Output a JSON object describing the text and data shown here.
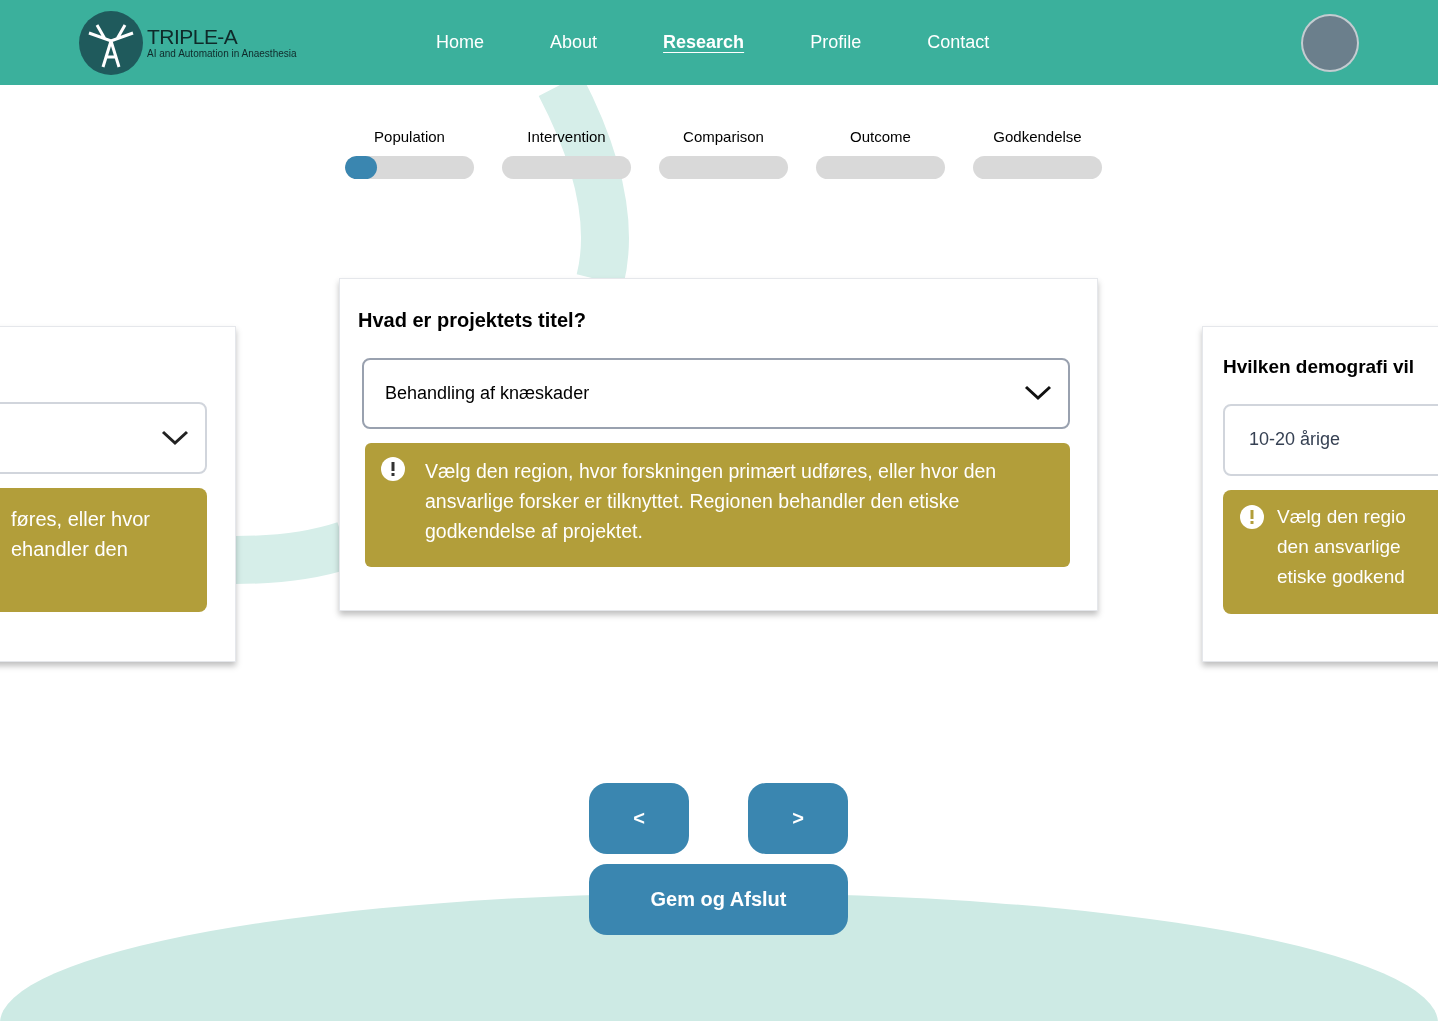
{
  "header": {
    "logo": {
      "title": "TRIPLE-A",
      "subtitle": "AI and Automation in Anaesthesia"
    },
    "nav": [
      {
        "label": "Home",
        "selected": false
      },
      {
        "label": "About",
        "selected": false
      },
      {
        "label": "Research",
        "selected": true
      },
      {
        "label": "Profile",
        "selected": false
      },
      {
        "label": "Contact",
        "selected": false
      }
    ]
  },
  "steps": [
    {
      "label": "Population",
      "level": 0.25
    },
    {
      "label": "Intervention",
      "level": 0
    },
    {
      "label": "Comparison",
      "level": 0
    },
    {
      "label": "Outcome",
      "level": 0
    },
    {
      "label": "Godkendelse",
      "level": 0
    }
  ],
  "left_card": {
    "notice_lines": [
      "føres, eller hvor",
      "ehandler den"
    ]
  },
  "card": {
    "question": "Hvad er projektets titel?",
    "value": "Behandling af knæskader",
    "notice": "Vælg den region, hvor forskningen primært udføres, eller hvor den ansvarlige forsker er tilknyttet. Regionen behandler den etiske godkendelse af projektet."
  },
  "right_card": {
    "question": "Hvilken demografi vil",
    "value": "10-20 årige",
    "notice_lines": [
      "Vælg den regio",
      "den ansvarlige",
      "etiske godkend"
    ]
  },
  "buttons": {
    "prev": "<",
    "next": ">",
    "save": "Gem og Afslut"
  }
}
